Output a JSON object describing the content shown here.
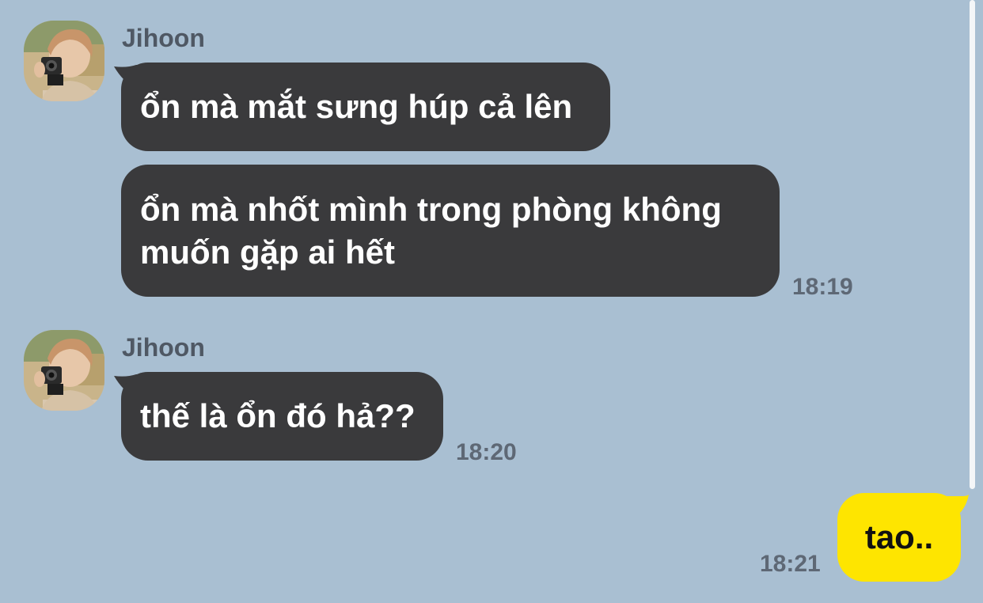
{
  "colors": {
    "background": "#a9bfd2",
    "received_bubble": "#3a3a3c",
    "sent_bubble": "#fee500",
    "sender_name": "#4f5864",
    "timestamp": "#5e6875"
  },
  "groups": [
    {
      "sender": "Jihoon",
      "avatar_icon": "user-photo-avatar",
      "messages": [
        "ổn mà mắt sưng húp cả lên",
        "ổn mà nhốt mình trong phòng không\nmuốn gặp ai hết"
      ],
      "time": "18:19"
    },
    {
      "sender": "Jihoon",
      "avatar_icon": "user-photo-avatar",
      "messages": [
        "thế là ổn đó hả??"
      ],
      "time": "18:20"
    }
  ],
  "sent": {
    "message": "tao..",
    "time": "18:21"
  }
}
